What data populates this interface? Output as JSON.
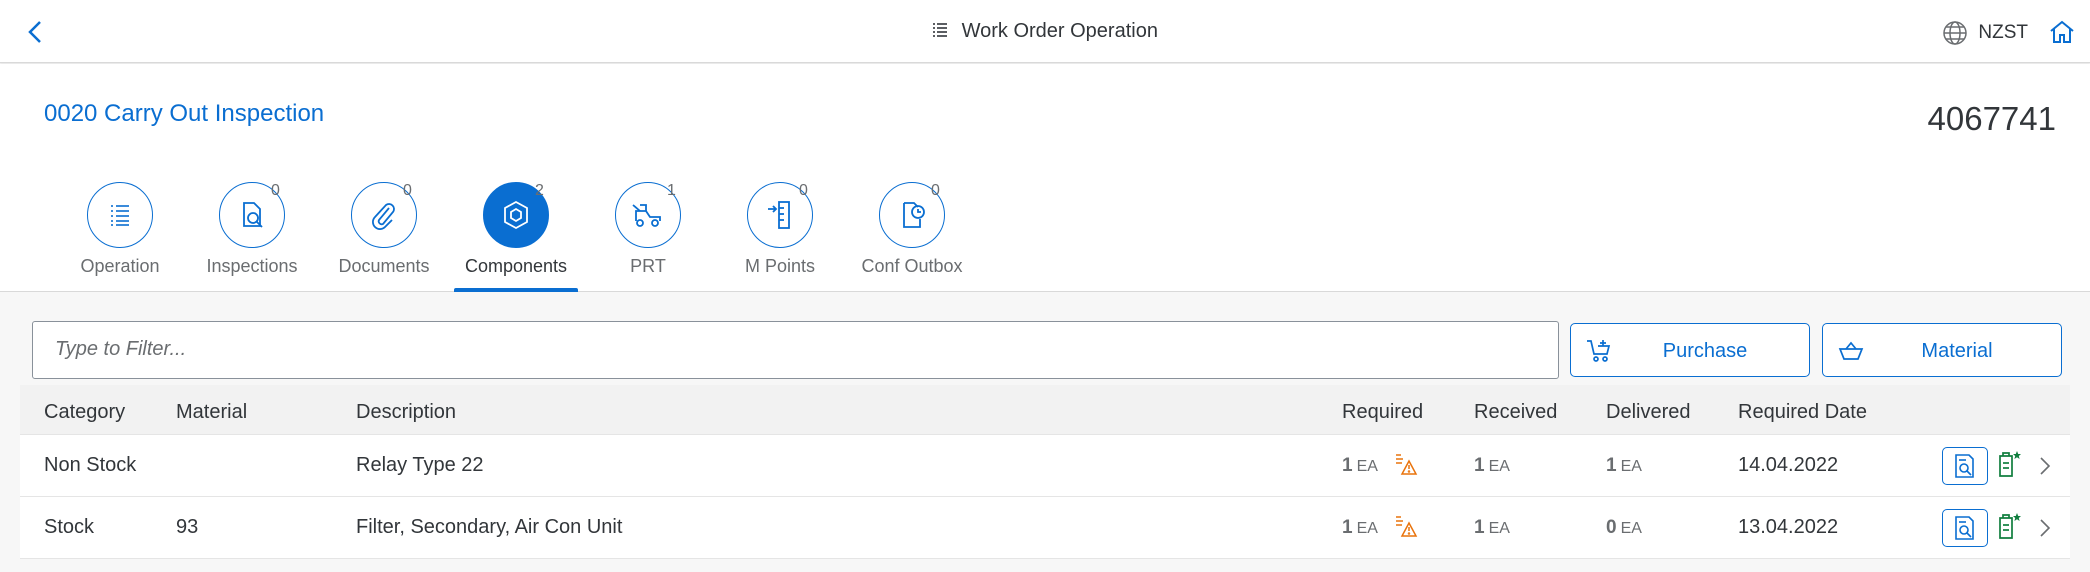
{
  "shell": {
    "title": "Work Order Operation",
    "timezone": "NZST"
  },
  "header": {
    "operation_title": "0020 Carry Out Inspection",
    "order_number": "4067741"
  },
  "tabs": [
    {
      "label": "Operation",
      "count": "",
      "icon": "list-icon"
    },
    {
      "label": "Inspections",
      "count": "0",
      "icon": "inspection-icon"
    },
    {
      "label": "Documents",
      "count": "0",
      "icon": "paperclip-icon"
    },
    {
      "label": "Components",
      "count": "2",
      "icon": "cube-icon",
      "selected": true
    },
    {
      "label": "PRT",
      "count": "1",
      "icon": "forklift-icon"
    },
    {
      "label": "M Points",
      "count": "0",
      "icon": "measurement-icon"
    },
    {
      "label": "Conf Outbox",
      "count": "0",
      "icon": "outbox-clock-icon"
    }
  ],
  "filter": {
    "placeholder": "Type to Filter..."
  },
  "actions": {
    "purchase_label": "Purchase",
    "material_label": "Material"
  },
  "table": {
    "columns": [
      "Category",
      "Material",
      "Description",
      "Required",
      "Received",
      "Delivered",
      "Required Date"
    ],
    "rows": [
      {
        "category": "Non Stock",
        "material": "",
        "description": "Relay Type 22",
        "required_qty": "1",
        "required_unit": "EA",
        "received_qty": "1",
        "received_unit": "EA",
        "delivered_qty": "1",
        "delivered_unit": "EA",
        "required_date": "14.04.2022"
      },
      {
        "category": "Stock",
        "material": "93",
        "description": "Filter, Secondary, Air Con Unit",
        "required_qty": "1",
        "required_unit": "EA",
        "received_qty": "1",
        "received_unit": "EA",
        "delivered_qty": "0",
        "delivered_unit": "EA",
        "required_date": "13.04.2022"
      }
    ]
  },
  "colors": {
    "accent": "#0a6ed1",
    "warning": "#e9730c",
    "positive": "#107e3e"
  }
}
